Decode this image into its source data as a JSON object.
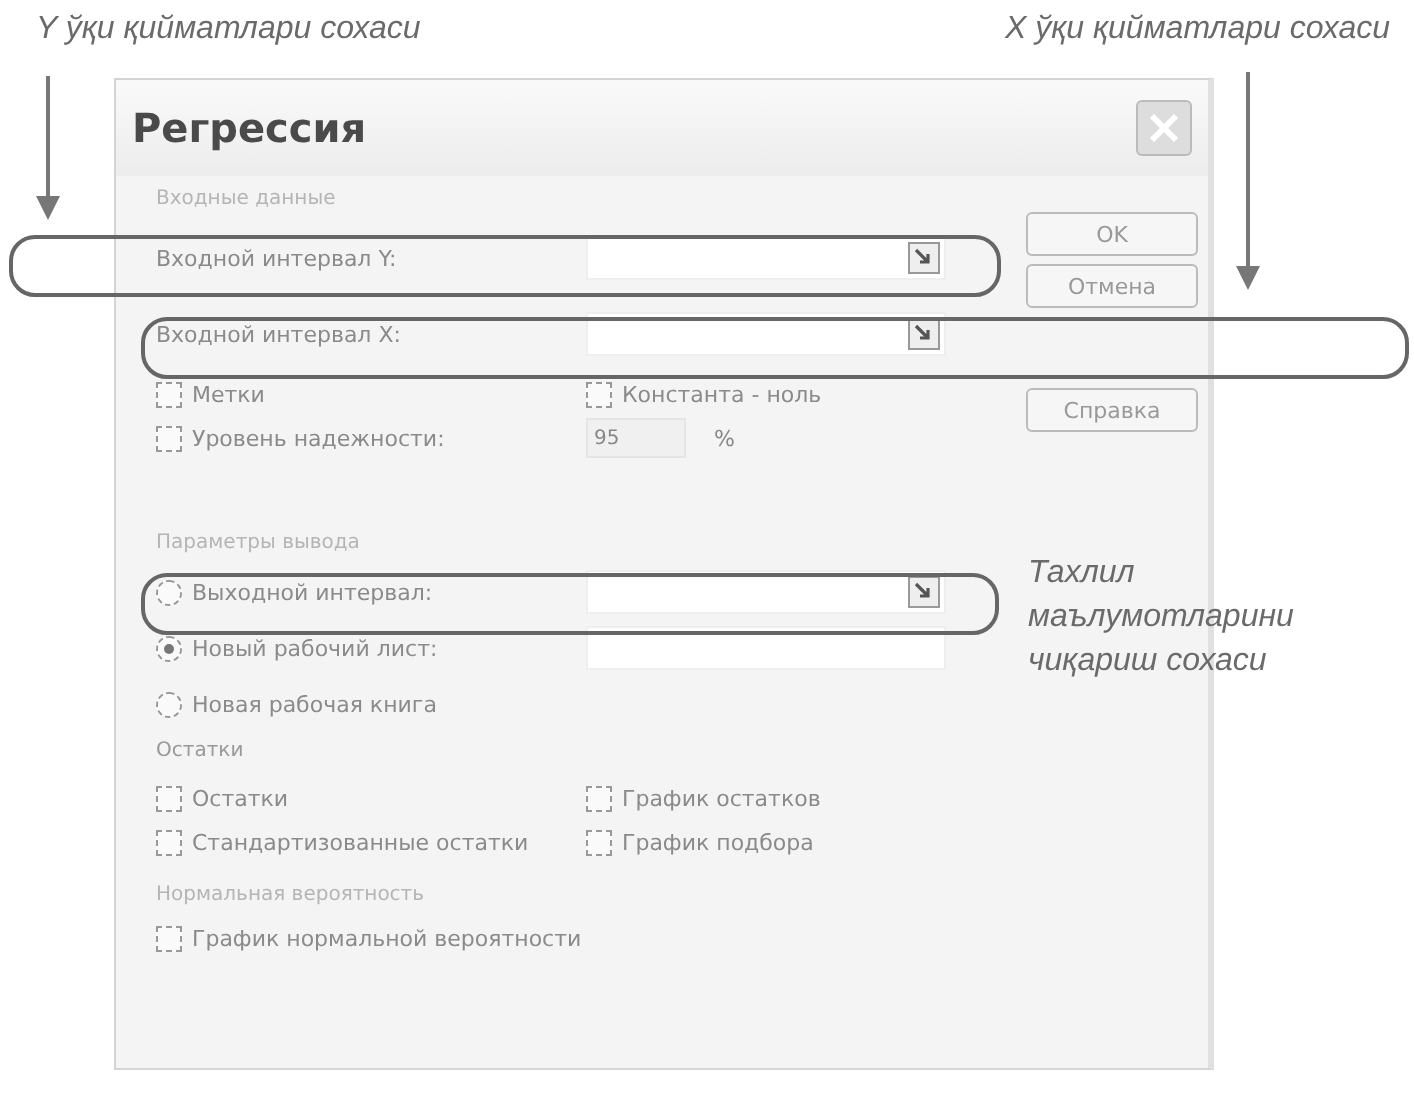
{
  "annotations": [
    {
      "text": "Y ўқи қийматлари сохаси"
    },
    {
      "text": "X ўқи қийматлари сохаси"
    },
    {
      "text": "Тахлил маълумотларини чиқариш сохаси"
    }
  ],
  "dialog": {
    "title": "Регрессия",
    "input_group": {
      "label": "Входные данные",
      "fields": [
        {
          "label": "Входной интервал Y:"
        },
        {
          "label": "Входной интервал X:"
        }
      ],
      "options": [
        {
          "label": "Метки",
          "checked": false
        },
        {
          "label": "Константа - ноль",
          "checked": false
        },
        {
          "label": "Уровень надежности:",
          "checked": false
        }
      ],
      "confidence": {
        "value": "95",
        "unit": "%",
        "disabled": true
      }
    },
    "output_group": {
      "label": "Параметры вывода",
      "choices": [
        {
          "label": "Выходной интервал:",
          "selected": false,
          "kind": "range"
        },
        {
          "label": "Новый рабочий лист:",
          "selected": true,
          "kind": "text"
        },
        {
          "label": "Новая рабочая книга",
          "selected": false,
          "kind": "none"
        }
      ]
    },
    "residuals": {
      "label": "Остатки",
      "options": [
        {
          "label": "Остатки",
          "checked": false
        },
        {
          "label": "График остатков",
          "checked": false
        },
        {
          "label": "Стандартизованные остатки",
          "checked": false
        },
        {
          "label": "График подбора",
          "checked": false
        }
      ]
    },
    "normal_probability": {
      "label": "Нормальная вероятность",
      "options": [
        {
          "label": "График нормальной вероятности",
          "checked": false
        }
      ]
    },
    "buttons": [
      "OK",
      "Отмена",
      "Справка"
    ]
  }
}
